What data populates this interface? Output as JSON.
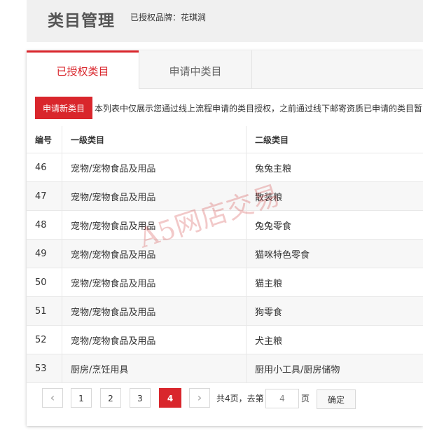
{
  "header": {
    "title": "类目管理",
    "brand_label": "已授权品牌：花琪涧"
  },
  "tabs": [
    {
      "label": "已授权类目",
      "active": true
    },
    {
      "label": "申请中类目",
      "active": false
    }
  ],
  "toolbar": {
    "apply_label": "申请新类目",
    "notice": "本列表中仅展示您通过线上流程申请的类目授权，之前通过线下邮寄资质已申请的类目暂"
  },
  "table": {
    "headers": [
      "编号",
      "一级类目",
      "二级类目"
    ],
    "rows": [
      [
        "46",
        "宠物/宠物食品及用品",
        "兔兔主粮"
      ],
      [
        "47",
        "宠物/宠物食品及用品",
        "散装粮"
      ],
      [
        "48",
        "宠物/宠物食品及用品",
        "兔兔零食"
      ],
      [
        "49",
        "宠物/宠物食品及用品",
        "猫咪特色零食"
      ],
      [
        "50",
        "宠物/宠物食品及用品",
        "猫主粮"
      ],
      [
        "51",
        "宠物/宠物食品及用品",
        "狗零食"
      ],
      [
        "52",
        "宠物/宠物食品及用品",
        "犬主粮"
      ],
      [
        "53",
        "厨房/烹饪用具",
        "厨用小工具/厨房储物"
      ]
    ]
  },
  "pager": {
    "prev": "‹",
    "pages": [
      "1",
      "2",
      "3",
      "4"
    ],
    "current": "4",
    "next": "›",
    "total_label": "共4页，去第",
    "goto_value": "4",
    "page_unit": "页",
    "confirm_label": "确定"
  },
  "watermark": "A5网店交易",
  "colors": {
    "accent": "#d9262c"
  }
}
